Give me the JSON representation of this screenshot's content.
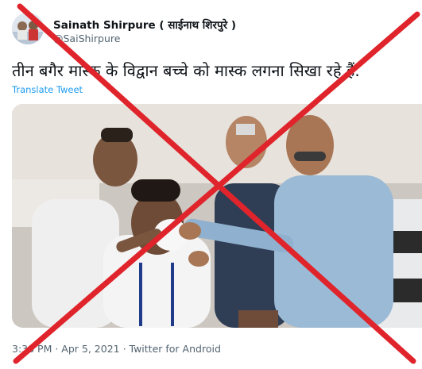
{
  "tweet": {
    "author_name": "Sainath Shirpure ( साईनाथ शिरपुरे )",
    "author_handle": "@SaiShirpure",
    "text": "तीन बगैर मास्क के विद्वान बच्चे को मास्क लगना सिखा रहे हैं.",
    "translate_label": "Translate Tweet",
    "meta": "3:38 PM · Apr 5, 2021 · Twitter for Android"
  },
  "icons": {
    "avatar": "profile-photo",
    "overlay": "red-x-mark"
  },
  "colors": {
    "link": "#1d9bf0",
    "secondary": "#536471",
    "cross": "#e0242b"
  }
}
